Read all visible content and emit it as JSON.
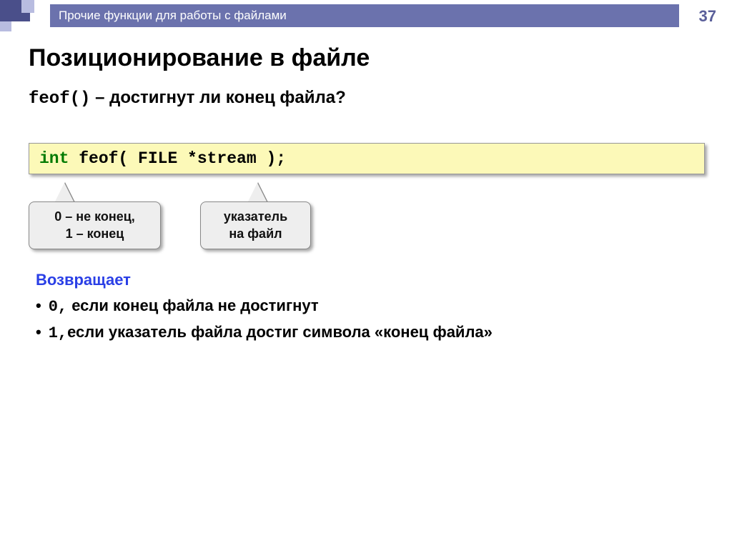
{
  "page_number": "37",
  "header": "Прочие функции для работы с файлами",
  "title": "Позиционирование в файле",
  "subtitle": {
    "func": "feof()",
    "dash": " – ",
    "text": "достигнут ли конец файла?"
  },
  "code": {
    "kw": "int",
    "rest": " feof( FILE *stream );"
  },
  "callouts": {
    "c1_line1": "0 – не конец,",
    "c1_line2": "1 – конец",
    "c2_line1": "указатель",
    "c2_line2": "на файл"
  },
  "returns": {
    "label": "Возвращает",
    "b1_code": "0,",
    "b1_text": " если конец файла не достигнут",
    "b2_code": "1,",
    "b2_text": "если указатель файла достиг символа «конец файла»"
  }
}
